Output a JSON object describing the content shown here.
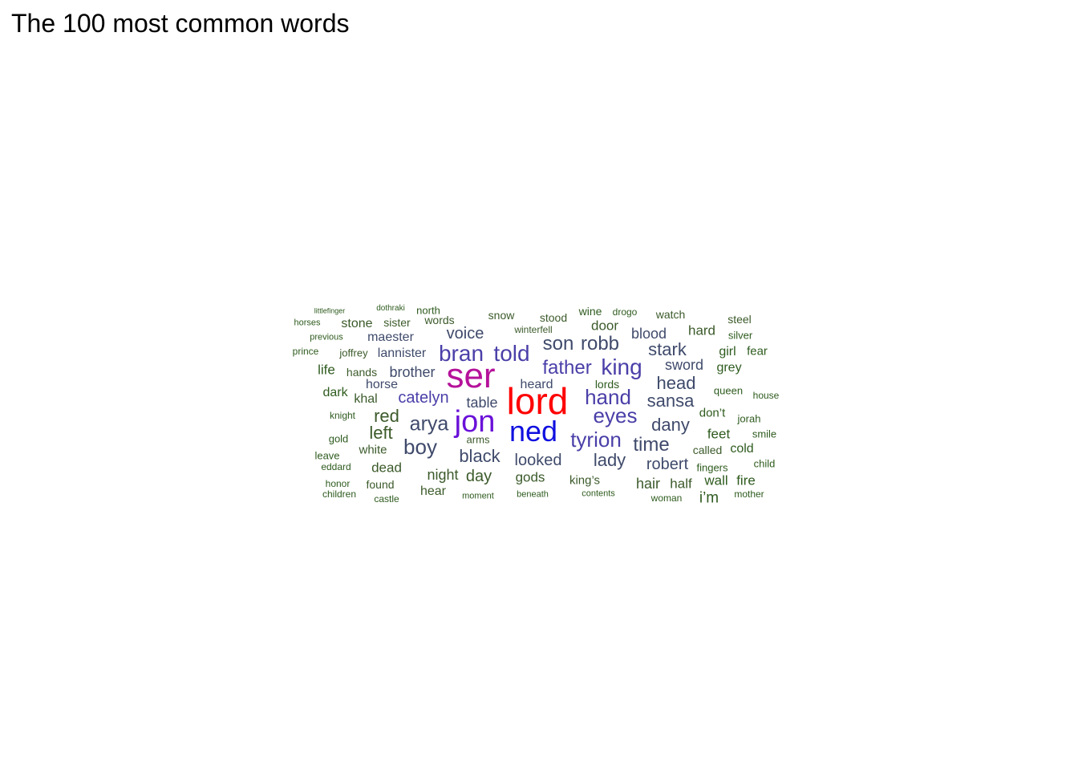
{
  "title": "The 100 most common words",
  "chart_data": {
    "type": "wordcloud",
    "title": "The 100 most common words",
    "colors": {
      "green": "#2e5b1e",
      "olive": "#3b5a2a",
      "slate": "#3f4a6b",
      "indigo": "#4a3fa8",
      "violet": "#6a11d8",
      "magenta": "#b5129a",
      "blue": "#1010e0",
      "red": "#ff0000"
    },
    "words": [
      {
        "text": "lord",
        "rank": 1,
        "color": "red"
      },
      {
        "text": "ser",
        "rank": 2,
        "color": "magenta"
      },
      {
        "text": "jon",
        "rank": 3,
        "color": "violet"
      },
      {
        "text": "ned",
        "rank": 4,
        "color": "blue"
      },
      {
        "text": "bran",
        "rank": 5,
        "color": "indigo"
      },
      {
        "text": "told",
        "rank": 6,
        "color": "indigo"
      },
      {
        "text": "king",
        "rank": 7,
        "color": "indigo"
      },
      {
        "text": "hand",
        "rank": 8,
        "color": "indigo"
      },
      {
        "text": "tyrion",
        "rank": 9,
        "color": "indigo"
      },
      {
        "text": "eyes",
        "rank": 10,
        "color": "indigo"
      },
      {
        "text": "arya",
        "rank": 11,
        "color": "slate"
      },
      {
        "text": "boy",
        "rank": 12,
        "color": "slate"
      },
      {
        "text": "father",
        "rank": 13,
        "color": "indigo"
      },
      {
        "text": "robb",
        "rank": 14,
        "color": "slate"
      },
      {
        "text": "son",
        "rank": 15,
        "color": "slate"
      },
      {
        "text": "time",
        "rank": 16,
        "color": "slate"
      },
      {
        "text": "stark",
        "rank": 17,
        "color": "slate"
      },
      {
        "text": "sansa",
        "rank": 18,
        "color": "slate"
      },
      {
        "text": "dany",
        "rank": 19,
        "color": "slate"
      },
      {
        "text": "black",
        "rank": 20,
        "color": "slate"
      },
      {
        "text": "lady",
        "rank": 21,
        "color": "slate"
      },
      {
        "text": "head",
        "rank": 22,
        "color": "slate"
      },
      {
        "text": "catelyn",
        "rank": 23,
        "color": "indigo"
      },
      {
        "text": "red",
        "rank": 24,
        "color": "olive"
      },
      {
        "text": "left",
        "rank": 25,
        "color": "olive"
      },
      {
        "text": "looked",
        "rank": 26,
        "color": "slate"
      },
      {
        "text": "robert",
        "rank": 27,
        "color": "slate"
      },
      {
        "text": "voice",
        "rank": 28,
        "color": "slate"
      },
      {
        "text": "brother",
        "rank": 29,
        "color": "slate"
      },
      {
        "text": "sword",
        "rank": 30,
        "color": "slate"
      },
      {
        "text": "table",
        "rank": 31,
        "color": "slate"
      },
      {
        "text": "day",
        "rank": 32,
        "color": "olive"
      },
      {
        "text": "maester",
        "rank": 33,
        "color": "slate"
      },
      {
        "text": "lannister",
        "rank": 34,
        "color": "slate"
      },
      {
        "text": "blood",
        "rank": 35,
        "color": "slate"
      },
      {
        "text": "hair",
        "rank": 36,
        "color": "olive"
      },
      {
        "text": "night",
        "rank": 37,
        "color": "olive"
      },
      {
        "text": "gods",
        "rank": 38,
        "color": "olive"
      },
      {
        "text": "heard",
        "rank": 39,
        "color": "slate"
      },
      {
        "text": "horse",
        "rank": 40,
        "color": "slate"
      },
      {
        "text": "dead",
        "rank": 41,
        "color": "olive"
      },
      {
        "text": "door",
        "rank": 42,
        "color": "olive"
      },
      {
        "text": "hard",
        "rank": 43,
        "color": "olive"
      },
      {
        "text": "i’m",
        "rank": 44,
        "color": "green"
      },
      {
        "text": "half",
        "rank": 45,
        "color": "olive"
      },
      {
        "text": "wall",
        "rank": 46,
        "color": "green"
      },
      {
        "text": "fire",
        "rank": 47,
        "color": "green"
      },
      {
        "text": "stone",
        "rank": 48,
        "color": "olive"
      },
      {
        "text": "hear",
        "rank": 49,
        "color": "olive"
      },
      {
        "text": "king’s",
        "rank": 50,
        "color": "olive"
      },
      {
        "text": "feet",
        "rank": 51,
        "color": "green"
      },
      {
        "text": "don’t",
        "rank": 52,
        "color": "green"
      },
      {
        "text": "girl",
        "rank": 53,
        "color": "green"
      },
      {
        "text": "grey",
        "rank": 54,
        "color": "green"
      },
      {
        "text": "fear",
        "rank": 55,
        "color": "green"
      },
      {
        "text": "dark",
        "rank": 56,
        "color": "green"
      },
      {
        "text": "life",
        "rank": 57,
        "color": "green"
      },
      {
        "text": "khal",
        "rank": 58,
        "color": "olive"
      },
      {
        "text": "hands",
        "rank": 59,
        "color": "olive"
      },
      {
        "text": "cold",
        "rank": 60,
        "color": "green"
      },
      {
        "text": "found",
        "rank": 61,
        "color": "olive"
      },
      {
        "text": "white",
        "rank": 62,
        "color": "olive"
      },
      {
        "text": "sister",
        "rank": 63,
        "color": "olive"
      },
      {
        "text": "words",
        "rank": 64,
        "color": "olive"
      },
      {
        "text": "snow",
        "rank": 65,
        "color": "olive"
      },
      {
        "text": "stood",
        "rank": 66,
        "color": "olive"
      },
      {
        "text": "steel",
        "rank": 67,
        "color": "olive"
      },
      {
        "text": "watch",
        "rank": 68,
        "color": "olive"
      },
      {
        "text": "wine",
        "rank": 69,
        "color": "green"
      },
      {
        "text": "joffrey",
        "rank": 70,
        "color": "olive"
      },
      {
        "text": "lords",
        "rank": 71,
        "color": "green"
      },
      {
        "text": "arms",
        "rank": 72,
        "color": "olive"
      },
      {
        "text": "queen",
        "rank": 73,
        "color": "green"
      },
      {
        "text": "called",
        "rank": 74,
        "color": "olive"
      },
      {
        "text": "silver",
        "rank": 75,
        "color": "green"
      },
      {
        "text": "north",
        "rank": 76,
        "color": "green"
      },
      {
        "text": "gold",
        "rank": 77,
        "color": "green"
      },
      {
        "text": "leave",
        "rank": 78,
        "color": "green"
      },
      {
        "text": "fingers",
        "rank": 79,
        "color": "green"
      },
      {
        "text": "child",
        "rank": 80,
        "color": "green"
      },
      {
        "text": "jorah",
        "rank": 81,
        "color": "green"
      },
      {
        "text": "smile",
        "rank": 82,
        "color": "green"
      },
      {
        "text": "prince",
        "rank": 83,
        "color": "green"
      },
      {
        "text": "winterfell",
        "rank": 84,
        "color": "olive"
      },
      {
        "text": "drogo",
        "rank": 85,
        "color": "green"
      },
      {
        "text": "house",
        "rank": 86,
        "color": "green"
      },
      {
        "text": "eddard",
        "rank": 87,
        "color": "green"
      },
      {
        "text": "knight",
        "rank": 88,
        "color": "green"
      },
      {
        "text": "honor",
        "rank": 89,
        "color": "green"
      },
      {
        "text": "children",
        "rank": 90,
        "color": "green"
      },
      {
        "text": "castle",
        "rank": 91,
        "color": "green"
      },
      {
        "text": "mother",
        "rank": 92,
        "color": "green"
      },
      {
        "text": "contents",
        "rank": 93,
        "color": "green"
      },
      {
        "text": "woman",
        "rank": 94,
        "color": "green"
      },
      {
        "text": "beneath",
        "rank": 95,
        "color": "green"
      },
      {
        "text": "moment",
        "rank": 96,
        "color": "green"
      },
      {
        "text": "previous",
        "rank": 97,
        "color": "green"
      },
      {
        "text": "horses",
        "rank": 98,
        "color": "green"
      },
      {
        "text": "dothraki",
        "rank": 99,
        "color": "green"
      },
      {
        "text": "littlefinger",
        "rank": 100,
        "color": "green"
      }
    ]
  }
}
